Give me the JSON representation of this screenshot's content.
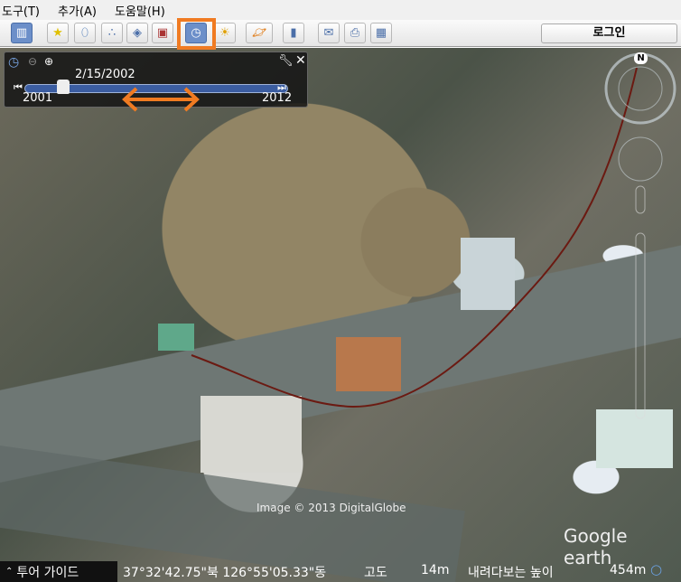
{
  "menu": [
    "도구(T)",
    "추가(A)",
    "도움말(H)"
  ],
  "toolbar": {
    "login_label": "로그인"
  },
  "time_slider": {
    "date": "2/15/2002",
    "start_year": "2001",
    "end_year": "2012",
    "position_fraction": 0.09
  },
  "compass": {
    "north_label": "N"
  },
  "map": {
    "copyright": "Image © 2013 DigitalGlobe",
    "logo": "Google earth"
  },
  "status": {
    "tour_guide": "투어 가이드",
    "coords": "37°32'42.75\"북 126°55'05.33\"동",
    "elev_label": "고도",
    "elev_value": "14m",
    "eye_label": "내려다보는 높이",
    "eye_value": "454m"
  },
  "colors": {
    "highlight": "#f07b22",
    "track": "#6b1a12",
    "slider": "#3b5da1"
  }
}
